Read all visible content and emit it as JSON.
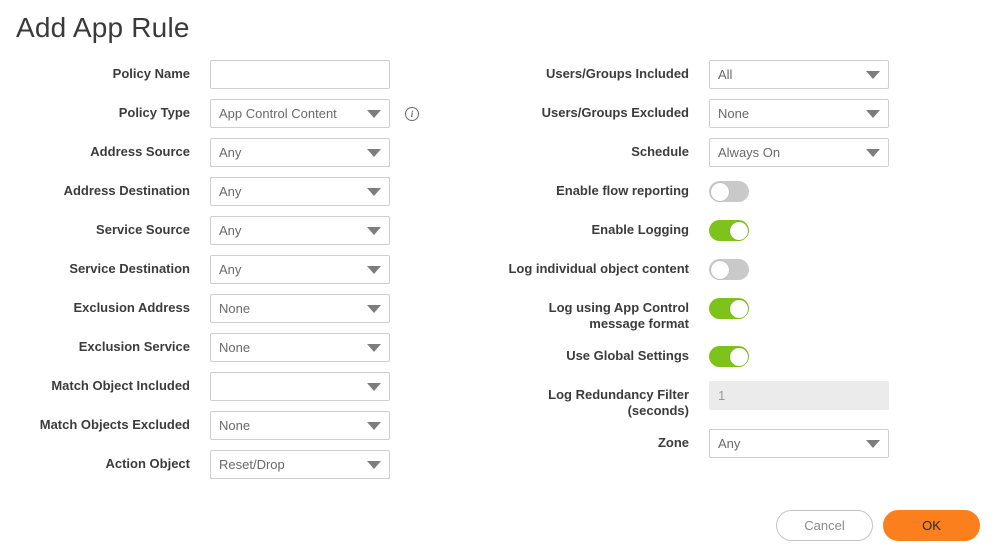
{
  "page": {
    "title": "Add App Rule"
  },
  "colors": {
    "toggle_on": "#7ec31c",
    "toggle_off": "#c9c9c9",
    "accent_ok": "#fb7f1d",
    "field_border": "#cfcfcf",
    "label_text": "#3c3c3c",
    "value_text": "#6a6a6a",
    "disabled_bg": "#ebebeb"
  },
  "left_column": [
    {
      "id": "policy-name",
      "label": "Policy Name",
      "type": "text",
      "value": "",
      "placeholder": ""
    },
    {
      "id": "policy-type",
      "label": "Policy Type",
      "type": "select",
      "value": "App Control Content",
      "info_icon": "info-icon",
      "info_tooltip": ""
    },
    {
      "id": "address-source",
      "label": "Address Source",
      "type": "select",
      "value": "Any"
    },
    {
      "id": "address-destination",
      "label": "Address Destination",
      "type": "select",
      "value": "Any"
    },
    {
      "id": "service-source",
      "label": "Service Source",
      "type": "select",
      "value": "Any"
    },
    {
      "id": "service-destination",
      "label": "Service Destination",
      "type": "select",
      "value": "Any"
    },
    {
      "id": "exclusion-address",
      "label": "Exclusion Address",
      "type": "select",
      "value": "None"
    },
    {
      "id": "exclusion-service",
      "label": "Exclusion Service",
      "type": "select",
      "value": "None"
    },
    {
      "id": "match-object-included",
      "label": "Match Object Included",
      "type": "select",
      "value": ""
    },
    {
      "id": "match-objects-excluded",
      "label": "Match Objects Excluded",
      "type": "select",
      "value": "None"
    },
    {
      "id": "action-object",
      "label": "Action Object",
      "type": "select",
      "value": "Reset/Drop"
    }
  ],
  "right_column": [
    {
      "id": "users-groups-included",
      "label": "Users/Groups Included",
      "type": "select",
      "value": "All"
    },
    {
      "id": "users-groups-excluded",
      "label": "Users/Groups Excluded",
      "type": "select",
      "value": "None"
    },
    {
      "id": "schedule",
      "label": "Schedule",
      "type": "select",
      "value": "Always On"
    },
    {
      "id": "enable-flow-reporting",
      "label": "Enable flow reporting",
      "type": "toggle",
      "state": "off"
    },
    {
      "id": "enable-logging",
      "label": "Enable Logging",
      "type": "toggle",
      "state": "on"
    },
    {
      "id": "log-individual-object-content",
      "label": "Log individual object content",
      "type": "toggle",
      "state": "off"
    },
    {
      "id": "log-using-app-control-message-format",
      "label": "Log using App Control message format",
      "type": "toggle",
      "state": "on"
    },
    {
      "id": "use-global-settings",
      "label": "Use Global Settings",
      "type": "toggle",
      "state": "on"
    },
    {
      "id": "log-redundancy-filter",
      "label": "Log Redundancy Filter (seconds)",
      "type": "text",
      "value": "1",
      "disabled": true
    },
    {
      "id": "zone",
      "label": "Zone",
      "type": "select",
      "value": "Any"
    }
  ],
  "footer": {
    "cancel_label": "Cancel",
    "ok_label": "OK"
  }
}
